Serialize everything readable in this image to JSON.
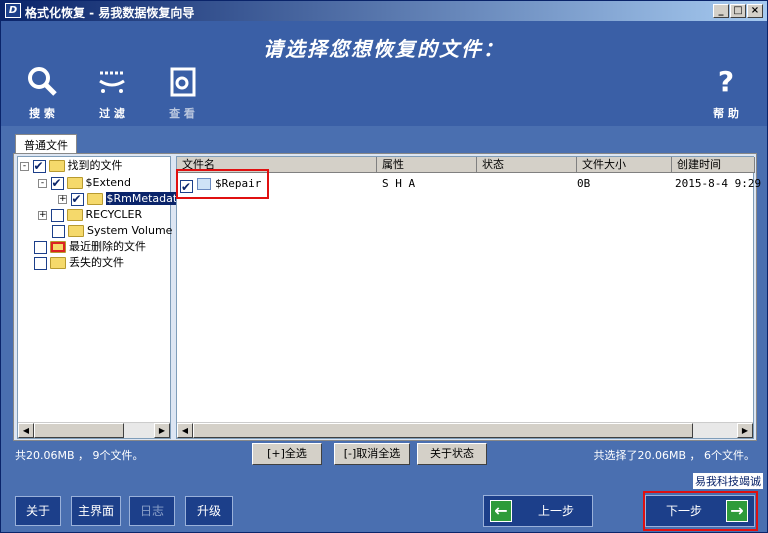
{
  "window": {
    "title": "格式化恢复 - 易我数据恢复向导",
    "icon_letter": "D"
  },
  "header": {
    "prompt": "请选择您想恢复的文件：",
    "buttons": [
      {
        "label": "搜 索",
        "icon": "magnifier-icon"
      },
      {
        "label": "过 滤",
        "icon": "filter-icon"
      },
      {
        "label": "查 看",
        "icon": "view-icon"
      },
      {
        "label": "帮 助",
        "icon": "help-icon"
      }
    ]
  },
  "tabs": [
    "普通文件"
  ],
  "tree": [
    {
      "label": "找到的文件",
      "checked": true,
      "expander": "-"
    },
    {
      "label": "$Extend",
      "checked": true,
      "expander": "-"
    },
    {
      "label": "$RmMetadat",
      "checked": true,
      "expander": "+",
      "selected": true
    },
    {
      "label": "RECYCLER",
      "checked": false,
      "expander": "+"
    },
    {
      "label": "System Volume",
      "checked": false,
      "expander": ""
    },
    {
      "label": "最近删除的文件",
      "checked": false,
      "expander": ""
    },
    {
      "label": "丢失的文件",
      "checked": false,
      "expander": ""
    }
  ],
  "list": {
    "columns": [
      "文件名",
      "属性",
      "状态",
      "文件大小",
      "创建时间"
    ],
    "rows": [
      {
        "name": "$Repair",
        "attr": "S H A",
        "status": "",
        "size": "0B",
        "created": "2015-8-4 9:29",
        "checked": true
      }
    ]
  },
  "status": {
    "left": "共20.06MB ， 9个文件。",
    "right": "共选择了20.06MB ， 6个文件。"
  },
  "controls": {
    "select_all": "[+]全选",
    "deselect_all": "[-]取消全选",
    "about_state": "关于状态"
  },
  "brand": "易我科技竭诚",
  "footer": {
    "about": "关于",
    "main": "主界面",
    "log": "日志",
    "upgrade": "升级",
    "prev": "上一步",
    "next": "下一步"
  },
  "colors": {
    "bg": "#4a6fb0",
    "header": "#3a5fa6",
    "button": "#1c3f8a",
    "highlight": "#e01010"
  }
}
